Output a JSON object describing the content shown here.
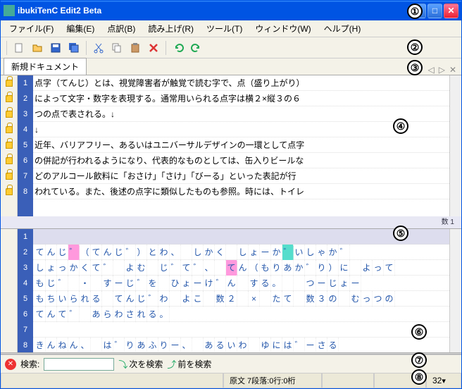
{
  "window": {
    "title": "ibukiTenC Edit2 Beta"
  },
  "menu": {
    "file": "ファイル(F)",
    "edit": "編集(E)",
    "braille": "点訳(B)",
    "read": "読み上げ(R)",
    "tool": "ツール(T)",
    "window": "ウィンドウ(W)",
    "help": "ヘルプ(H)"
  },
  "tab": {
    "label": "新規ドキュメント"
  },
  "top_lines": [
    "点字（てんじ）とは、視覚障害者が触覚で読む字で、点（盛り上がり）",
    "によって文字・数字を表現する。通常用いられる点字は横２×縦３の６",
    "つの点で表される。↓",
    "↓",
    "近年、バリアフリー、あるいはユニバーサルデザインの一環として点字",
    "の併記が行われるようになり、代表的なものとしては、缶入りビールな",
    "どのアルコール飲料に「おさけ」「さけ」「びーる」といった表記が行",
    "われている。また、後述の点字に類似したものも参照。時には、トイレ"
  ],
  "ruler": {
    "label": "数 1"
  },
  "bottom_lines": [
    {
      "t": ""
    },
    {
      "t": "てんじ゛（てんじ゛）とわ、　しかく　しょーか゛いしゃか゛",
      "pink": [
        3
      ],
      "cyan": [
        22
      ]
    },
    {
      "t": "しょっかくて゛　よむ　じ゛て゛、　てん（もりあか゛り）に　よって",
      "pink": [
        17
      ]
    },
    {
      "t": "もじ゛　・　すーじ゛を　ひょーけ゛ん　する。　　つーじょー"
    },
    {
      "t": "もちいられる　てんじ゛わ　よこ　数２　×　たて　数３の　むっつの"
    },
    {
      "t": "てんて゛　あらわされる。"
    },
    {
      "t": ""
    },
    {
      "t": "きんねん、　は゛りあふりー、　あるいわ　ゆには゛ーさる",
      "cyan": [
        27
      ]
    }
  ],
  "search": {
    "label": "検索:",
    "value": "",
    "next": "次を検索",
    "prev": "前を検索"
  },
  "status": {
    "pos": "原文 7段落:0行:0桁",
    "line": "32"
  },
  "annotations": [
    "①",
    "②",
    "③",
    "④",
    "⑤",
    "⑥",
    "⑦",
    "⑧"
  ]
}
